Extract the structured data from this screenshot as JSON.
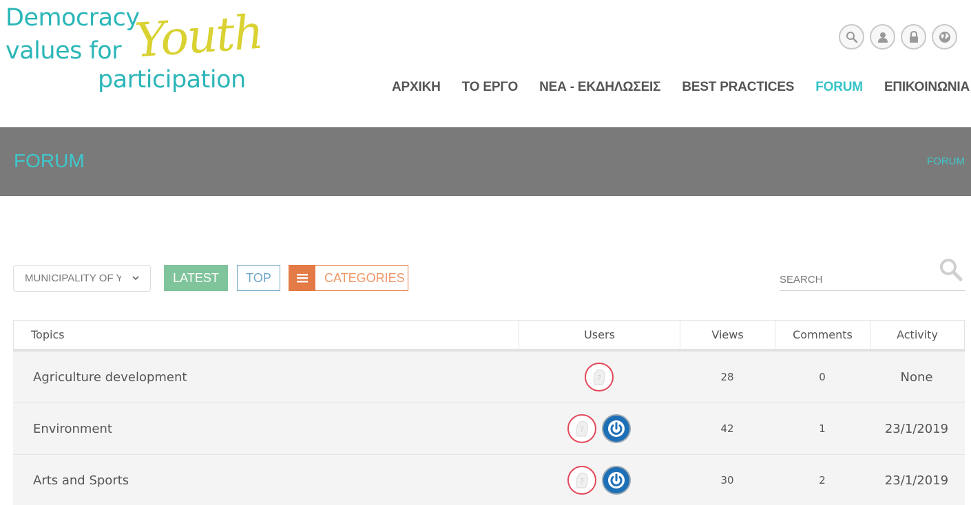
{
  "logo": {
    "line1": "Democracy",
    "line2": "values for",
    "line3": "participation",
    "youth": "Youth",
    "colors": {
      "teal": "#2bb6b8",
      "yellow": "#d9d232"
    }
  },
  "header_icons": [
    "search-icon",
    "user-icon",
    "lock-icon",
    "globe-icon"
  ],
  "nav": {
    "items": [
      {
        "label": "ΑΡΧΙΚΗ"
      },
      {
        "label": "ΤΟ ΕΡΓΟ"
      },
      {
        "label": "ΝΕΑ - ΕΚΔΗΛΩΣΕΙΣ"
      },
      {
        "label": "BEST PRACTICES"
      },
      {
        "label": "FORUM",
        "active": true
      },
      {
        "label": "ΕΠΙΚΟΙΝΩΝΙΑ"
      }
    ],
    "active_color": "#35c4c8"
  },
  "banner": {
    "title": "FORUM",
    "breadcrumb": "FORUM",
    "background": "#7a7a7a"
  },
  "toolbar": {
    "municipality_select": "MUNICIPALITY OF YOUTH",
    "latest_label": "LATEST",
    "top_label": "TOP",
    "categories_label": "CATEGORIES",
    "search_placeholder": "SEARCH",
    "colors": {
      "latest": "#7fc49a",
      "top": "#6fa7c9",
      "categories": "#e47a45"
    }
  },
  "table": {
    "headers": {
      "topics": "Topics",
      "users": "Users",
      "views": "Views",
      "comments": "Comments",
      "activity": "Activity"
    },
    "rows": [
      {
        "topic": "Agriculture development",
        "users": [
          "anonymous-avatar-icon"
        ],
        "views": "28",
        "comments": "0",
        "activity": "None"
      },
      {
        "topic": "Environment",
        "users": [
          "anonymous-avatar-icon",
          "power-avatar-icon"
        ],
        "views": "42",
        "comments": "1",
        "activity": "23/1/2019"
      },
      {
        "topic": "Arts and Sports",
        "users": [
          "anonymous-avatar-icon",
          "power-avatar-icon"
        ],
        "views": "30",
        "comments": "2",
        "activity": "23/1/2019"
      }
    ]
  }
}
